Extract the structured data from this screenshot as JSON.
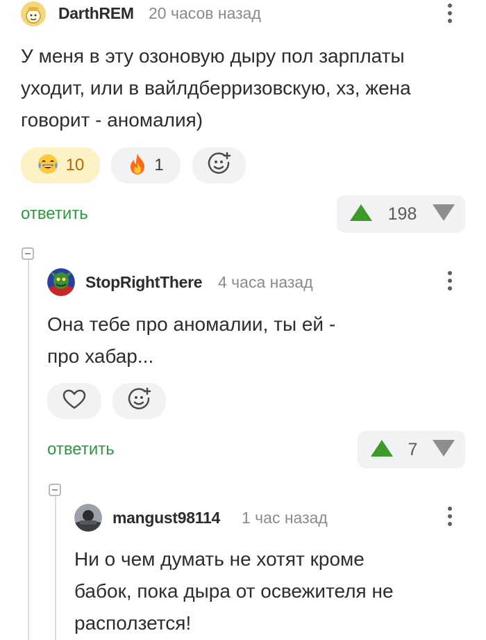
{
  "comments": [
    {
      "username": "DarthREM",
      "time": "20 часов назад",
      "text_lines": [
        "У меня в эту озоновую дыру пол зарплаты",
        "уходит, или в вайлдберризовскую, хз, жена",
        "говорит - аномалия)"
      ],
      "reactions": [
        {
          "icon": "laughing-tears-emoji-icon",
          "count": "10"
        },
        {
          "icon": "fire-emoji-icon",
          "count": "1"
        }
      ],
      "reply_label": "ответить",
      "rating": "198"
    },
    {
      "username": "StopRightThere",
      "time": "4 часа назад",
      "text_lines": [
        "Она тебе про аномалии, ты ей -",
        "про хабар..."
      ],
      "reply_label": "ответить",
      "rating": "7"
    },
    {
      "username": "mangust98114",
      "time": "1 час назад",
      "text_lines": [
        "Ни о чем думать не хотят кроме",
        "бабок, пока дыра от освежителя не",
        "расползется!"
      ]
    }
  ],
  "colors": {
    "accent_green": "#2b9a3e",
    "upvote_green": "#3e9a2a",
    "pill_bg": "#f1f2f4",
    "active_reaction_bg": "#fdf1c6"
  }
}
